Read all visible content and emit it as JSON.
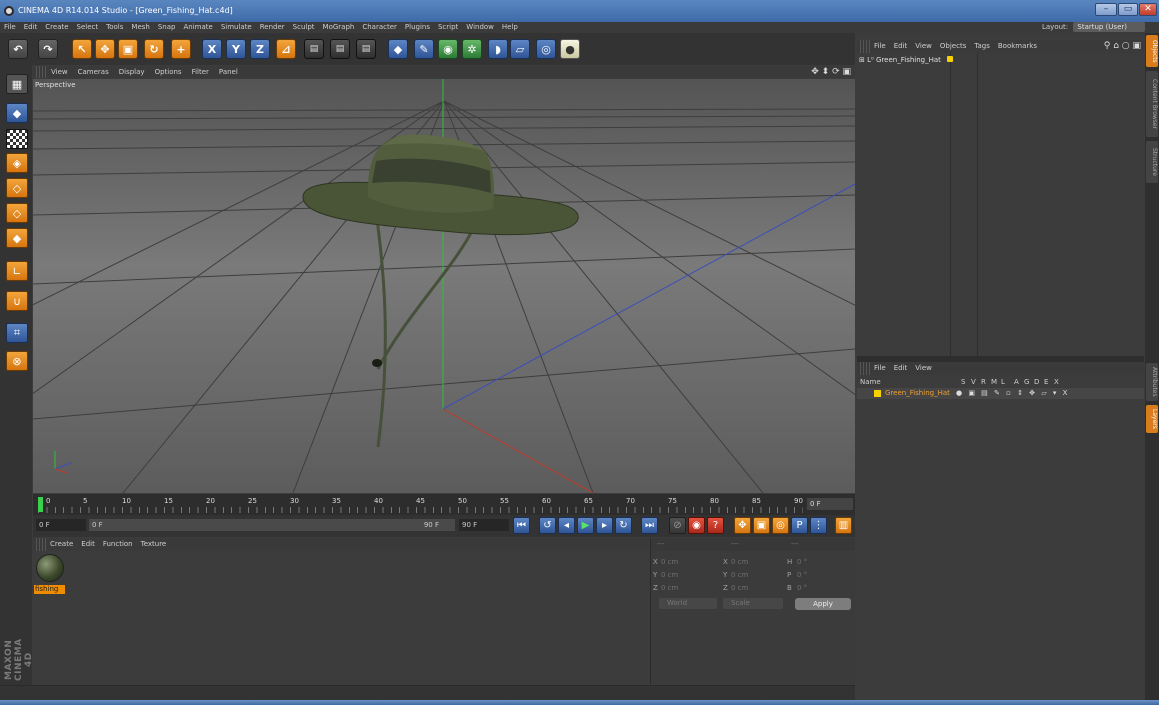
{
  "window": {
    "title": "CINEMA 4D R14.014 Studio - [Green_Fishing_Hat.c4d]"
  },
  "menubar": {
    "items": [
      "File",
      "Edit",
      "Create",
      "Select",
      "Tools",
      "Mesh",
      "Snap",
      "Animate",
      "Simulate",
      "Render",
      "Sculpt",
      "MoGraph",
      "Character",
      "Plugins",
      "Script",
      "Window",
      "Help"
    ],
    "layout_label": "Layout:",
    "layout_value": "Startup (User)"
  },
  "toolbar": {
    "x_axis": "X",
    "y_axis": "Y",
    "z_axis": "Z"
  },
  "viewport": {
    "menu": [
      "View",
      "Cameras",
      "Display",
      "Options",
      "Filter",
      "Panel"
    ],
    "label": "Perspective"
  },
  "timeline": {
    "ticks": [
      "0",
      "5",
      "10",
      "15",
      "20",
      "25",
      "30",
      "35",
      "40",
      "45",
      "50",
      "55",
      "60",
      "65",
      "70",
      "75",
      "80",
      "85",
      "90"
    ],
    "current_frame": "0 F"
  },
  "transport": {
    "start_frame": "0 F",
    "slider_start": "0 F",
    "slider_end": "90 F",
    "end_frame": "90 F"
  },
  "material_manager": {
    "menu": [
      "Create",
      "Edit",
      "Function",
      "Texture"
    ],
    "material_name": "fishing"
  },
  "coordinates": {
    "header": "---",
    "header2": "---",
    "header3": "---",
    "rows": [
      {
        "a1": "X",
        "v1": "0 cm",
        "a2": "X",
        "v2": "0 cm",
        "a3": "H",
        "v3": "0 °"
      },
      {
        "a1": "Y",
        "v1": "0 cm",
        "a2": "Y",
        "v2": "0 cm",
        "a3": "P",
        "v3": "0 °"
      },
      {
        "a1": "Z",
        "v1": "0 cm",
        "a2": "Z",
        "v2": "0 cm",
        "a3": "B",
        "v3": "0 °"
      }
    ],
    "space": "World",
    "mode": "Scale",
    "apply": "Apply"
  },
  "object_manager": {
    "menu": [
      "File",
      "Edit",
      "View",
      "Objects",
      "Tags",
      "Bookmarks"
    ],
    "object_name": "Green_Fishing_Hat"
  },
  "layer_manager": {
    "menu": [
      "File",
      "Edit",
      "View"
    ],
    "col_name": "Name",
    "columns": [
      "S",
      "V",
      "R",
      "M",
      "L",
      "A",
      "G",
      "D",
      "E",
      "X"
    ],
    "layer_name": "Green_Fishing_Hat"
  },
  "side_tabs": [
    "Objects",
    "Content Browser",
    "Structure",
    "Attributes",
    "Layers"
  ],
  "branding": {
    "logo_text": "MAXON CINEMA 4D"
  },
  "colors": {
    "accent_orange": "#d97c1b",
    "tool_blue": "#3f67a8",
    "hat_green": "#4d5a3a"
  }
}
